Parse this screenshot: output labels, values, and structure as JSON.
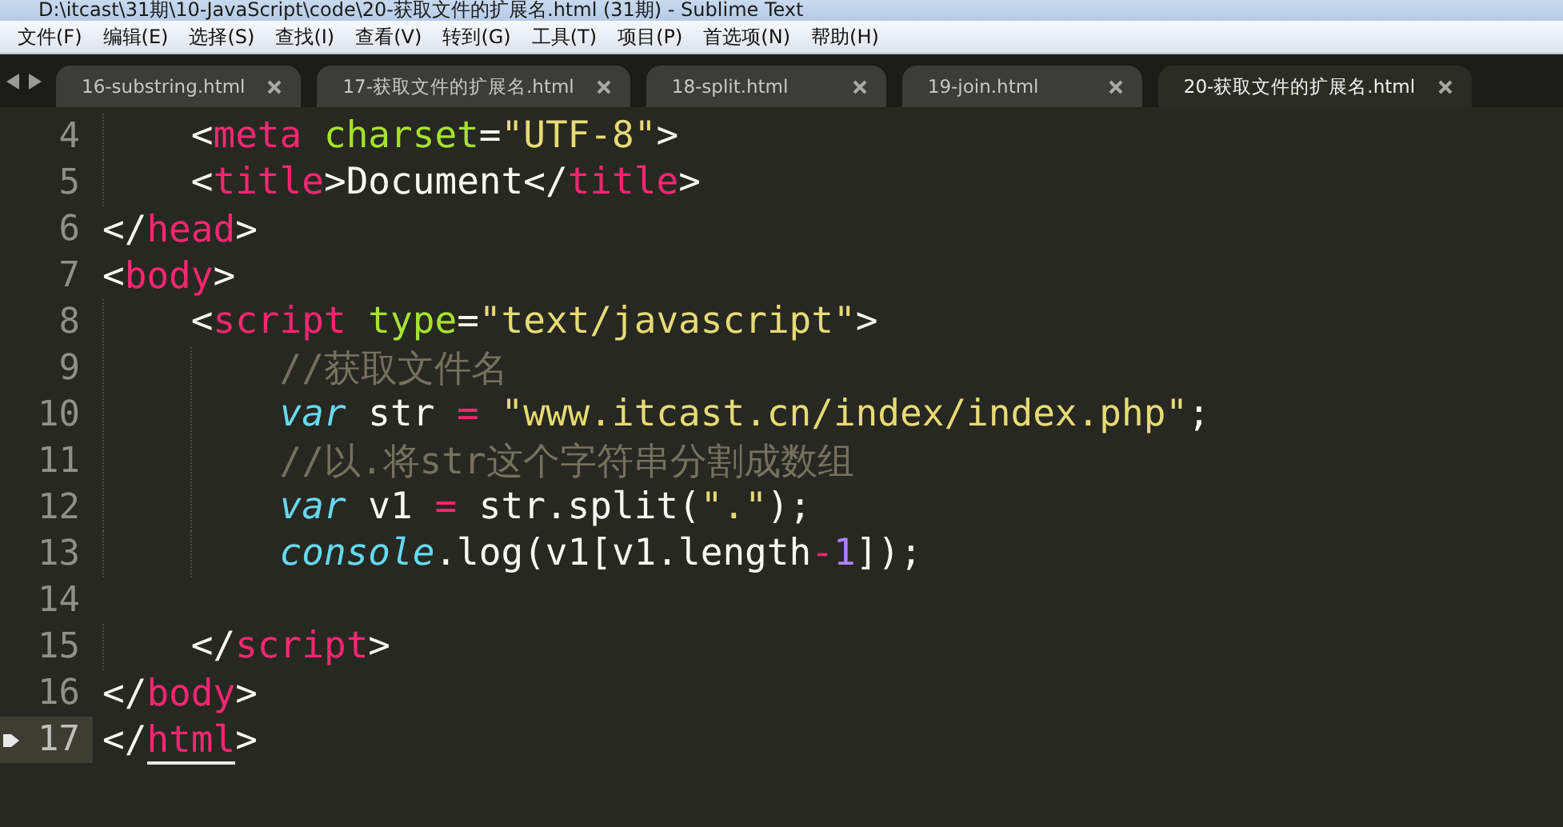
{
  "window": {
    "title": "D:\\itcast\\31期\\10-JavaScript\\code\\20-获取文件的扩展名.html (31期) - Sublime Text"
  },
  "menu": [
    "文件(F)",
    "编辑(E)",
    "选择(S)",
    "查找(I)",
    "查看(V)",
    "转到(G)",
    "工具(T)",
    "项目(P)",
    "首选项(N)",
    "帮助(H)"
  ],
  "tabs": [
    {
      "label": "16-substring.html",
      "selected": false
    },
    {
      "label": "17-获取文件的扩展名.html",
      "selected": false
    },
    {
      "label": "18-split.html",
      "selected": false
    },
    {
      "label": "19-join.html",
      "selected": false
    },
    {
      "label": "20-获取文件的扩展名.html",
      "selected": true
    }
  ],
  "editor": {
    "lines": [
      {
        "number": "4",
        "current": false,
        "tokens": [
          {
            "kind": "punct",
            "text": "    <"
          },
          {
            "kind": "tag",
            "text": "meta"
          },
          {
            "kind": "attr",
            "text": " charset"
          },
          {
            "kind": "punct",
            "text": "="
          },
          {
            "kind": "string",
            "text": "\"UTF-8\""
          },
          {
            "kind": "punct",
            "text": ">"
          }
        ]
      },
      {
        "number": "5",
        "current": false,
        "tokens": [
          {
            "kind": "punct",
            "text": "    <"
          },
          {
            "kind": "tag",
            "text": "title"
          },
          {
            "kind": "punct",
            "text": ">Document</"
          },
          {
            "kind": "tag",
            "text": "title"
          },
          {
            "kind": "punct",
            "text": ">"
          }
        ]
      },
      {
        "number": "6",
        "current": false,
        "tokens": [
          {
            "kind": "punct",
            "text": "</"
          },
          {
            "kind": "tag",
            "text": "head"
          },
          {
            "kind": "punct",
            "text": ">"
          }
        ]
      },
      {
        "number": "7",
        "current": false,
        "tokens": [
          {
            "kind": "punct",
            "text": "<"
          },
          {
            "kind": "tag",
            "text": "body"
          },
          {
            "kind": "punct",
            "text": ">"
          }
        ]
      },
      {
        "number": "8",
        "current": false,
        "tokens": [
          {
            "kind": "punct",
            "text": "    <"
          },
          {
            "kind": "tag",
            "text": "script"
          },
          {
            "kind": "attr",
            "text": " type"
          },
          {
            "kind": "punct",
            "text": "="
          },
          {
            "kind": "string",
            "text": "\"text/javascript\""
          },
          {
            "kind": "punct",
            "text": ">"
          }
        ]
      },
      {
        "number": "9",
        "current": false,
        "tokens": [
          {
            "kind": "comment",
            "text": "        //获取文件名"
          }
        ]
      },
      {
        "number": "10",
        "current": false,
        "tokens": [
          {
            "kind": "keyword",
            "text": "        var"
          },
          {
            "kind": "punct",
            "text": " str "
          },
          {
            "kind": "operator",
            "text": "="
          },
          {
            "kind": "string",
            "text": " \"www.itcast.cn/index/index.php\""
          },
          {
            "kind": "punct",
            "text": ";"
          }
        ]
      },
      {
        "number": "11",
        "current": false,
        "tokens": [
          {
            "kind": "comment",
            "text": "        //以.将str这个字符串分割成数组"
          }
        ]
      },
      {
        "number": "12",
        "current": false,
        "tokens": [
          {
            "kind": "keyword",
            "text": "        var"
          },
          {
            "kind": "punct",
            "text": " v1 "
          },
          {
            "kind": "operator",
            "text": "="
          },
          {
            "kind": "punct",
            "text": " str.split("
          },
          {
            "kind": "string",
            "text": "\".\""
          },
          {
            "kind": "punct",
            "text": ");"
          }
        ]
      },
      {
        "number": "13",
        "current": false,
        "tokens": [
          {
            "kind": "keyword",
            "text": "        console"
          },
          {
            "kind": "punct",
            "text": ".log(v1[v1.length"
          },
          {
            "kind": "operator",
            "text": "-"
          },
          {
            "kind": "number",
            "text": "1"
          },
          {
            "kind": "punct",
            "text": "]);"
          }
        ]
      },
      {
        "number": "14",
        "current": false
      },
      {
        "number": "15",
        "current": false,
        "tokens": [
          {
            "kind": "punct",
            "text": "    </"
          },
          {
            "kind": "tag",
            "text": "script"
          },
          {
            "kind": "punct",
            "text": ">"
          }
        ]
      },
      {
        "number": "16",
        "current": false,
        "tokens": [
          {
            "kind": "punct",
            "text": "</"
          },
          {
            "kind": "tag",
            "text": "body"
          },
          {
            "kind": "punct",
            "text": ">"
          }
        ]
      },
      {
        "number": "17",
        "current": true,
        "bookmark": true,
        "tokens": [
          {
            "kind": "punct",
            "text": "</"
          },
          {
            "kind": "tag",
            "text": "html",
            "matched": true
          },
          {
            "kind": "punct",
            "text": ">"
          }
        ]
      }
    ]
  }
}
